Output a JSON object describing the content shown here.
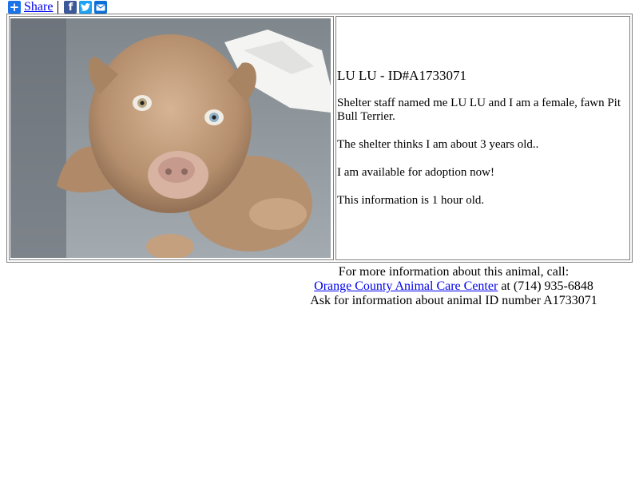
{
  "share": {
    "label": "Share",
    "icons": [
      "plus-icon",
      "facebook-icon",
      "twitter-icon",
      "email-icon"
    ]
  },
  "animal": {
    "title": "LU LU - ID#A1733071",
    "description": "Shelter staff named me LU LU and I am a female, fawn Pit Bull Terrier.",
    "age": "The shelter thinks I am about 3 years old..",
    "status": "I am available for adoption now!",
    "freshness": "This information is 1 hour old.",
    "photo_subject": "fawn pit bull terrier lying on grey carpet"
  },
  "contact": {
    "line1": "For more information about this animal, call:",
    "shelter_name": "Orange County Animal Care Center",
    "phone_text": " at (714) 935-6848",
    "line3": "Ask for information about animal ID number A1733071"
  },
  "colors": {
    "link": "#0000ee",
    "share_blue": "#1a73e8",
    "facebook": "#3b5998",
    "twitter": "#1da1f2",
    "table_border": "#808080"
  }
}
